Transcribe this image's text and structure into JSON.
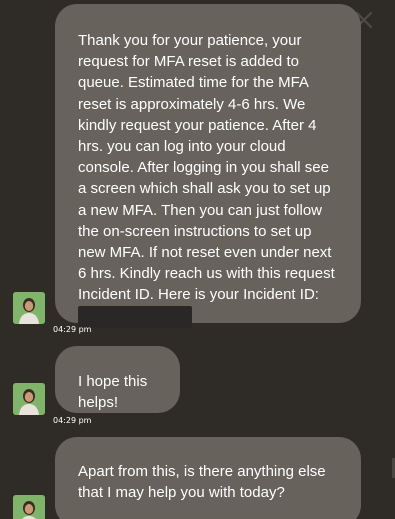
{
  "header": {
    "minimize_icon": "collapse-arrows-icon",
    "close_icon": "close-icon"
  },
  "messages": [
    {
      "text": "Thank you for your patience, your request for MFA reset is added to queue. Estimated time for the MFA reset is approximately 4-6 hrs. We kindly request your patience. After 4 hrs. you can log into your cloud console. After logging in you shall see a screen which shall ask you to set up a new MFA. Then you can just follow the on-screen instructions to set up new MFA. If not reset even under next 6 hrs. Kindly reach us with this request Incident ID. Here is your Incident ID:",
      "time": "04:29 pm"
    },
    {
      "text": "I hope this helps!",
      "time": "04:29 pm"
    },
    {
      "text": "Apart from this, is there anything else that I may help you with today?"
    }
  ],
  "colors": {
    "background": "#2f2c28",
    "bubble": "#67625c",
    "avatar_bg": "#7fb46a"
  }
}
